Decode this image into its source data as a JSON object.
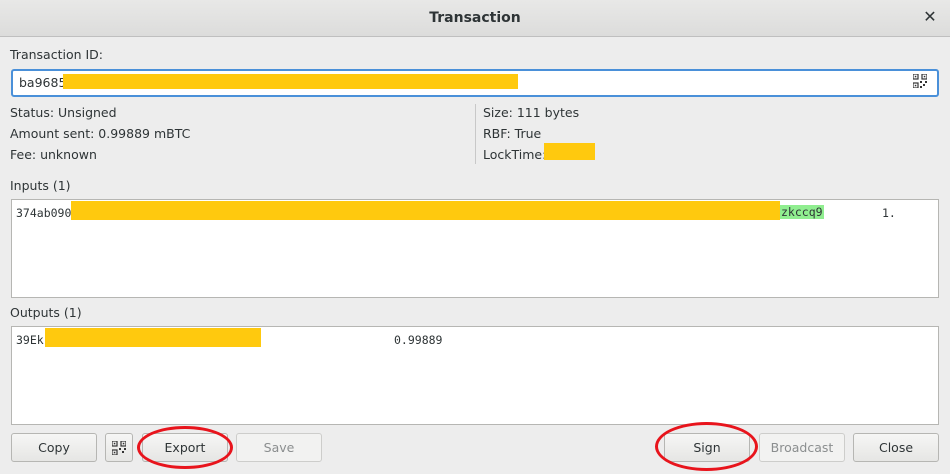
{
  "window": {
    "title": "Transaction"
  },
  "txid": {
    "label": "Transaction ID:",
    "value_prefix": "ba9685"
  },
  "details_left": {
    "status": "Status: Unsigned",
    "amount": "Amount sent: 0.99889 mBTC",
    "fee": "Fee: unknown"
  },
  "details_right": {
    "size": "Size: 111 bytes",
    "rbf": "RBF: True",
    "locktime": "LockTime:"
  },
  "inputs": {
    "label": "Inputs (1)",
    "rows": [
      {
        "prefix": "374ab090",
        "address_suffix": "zkccq9",
        "amount": "1."
      }
    ]
  },
  "outputs": {
    "label": "Outputs (1)",
    "rows": [
      {
        "prefix": "39Ek",
        "amount": "0.99889"
      }
    ]
  },
  "buttons": {
    "copy": "Copy",
    "export": "Export",
    "save": "Save",
    "sign": "Sign",
    "broadcast": "Broadcast",
    "close": "Close"
  },
  "colors": {
    "redaction": "#ffc90e",
    "highlight": "#90ee90",
    "annotation": "#e8141c",
    "focus": "#4a90d9"
  },
  "icons": [
    "close-icon",
    "qr-code-icon"
  ]
}
